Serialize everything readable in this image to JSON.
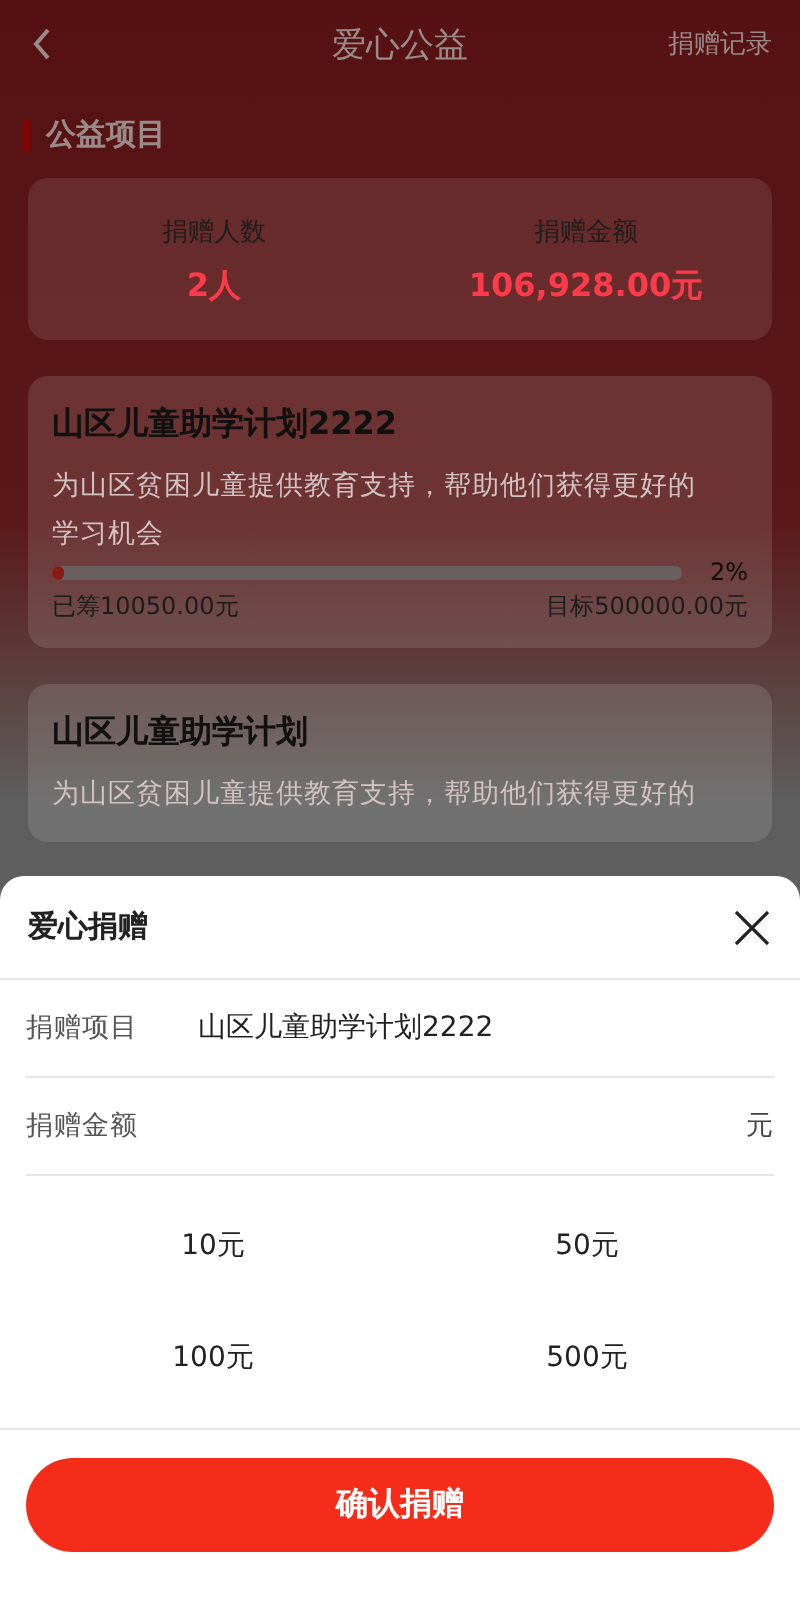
{
  "nav": {
    "title": "爱心公益",
    "action": "捐赠记录"
  },
  "section_title": "公益项目",
  "stats": [
    {
      "label": "捐赠人数",
      "value": "2人"
    },
    {
      "label": "捐赠金额",
      "value": "106,928.00元"
    }
  ],
  "projects": [
    {
      "title": "山区儿童助学计划2222",
      "description": "为山区贫困儿童提供教育支持，帮助他们获得更好的学习机会",
      "level": 0.02,
      "percent": "2%",
      "raised": "已筹10050.00元",
      "target": "目标500000.00元"
    },
    {
      "title": "山区儿童助学计划",
      "description": "为山区贫困儿童提供教育支持，帮助他们获得更好的"
    }
  ],
  "sheet": {
    "title": "爱心捐赠",
    "project_label": "捐赠项目",
    "project_value": "山区儿童助学计划2222",
    "amount_label": "捐赠金额",
    "amount_unit": "元",
    "presets": [
      {
        "label": "10元",
        "selected": false
      },
      {
        "label": "50元",
        "selected": false
      },
      {
        "label": "100元",
        "selected": false
      },
      {
        "label": "500元",
        "selected": false
      }
    ],
    "confirm": "确认捐赠"
  }
}
